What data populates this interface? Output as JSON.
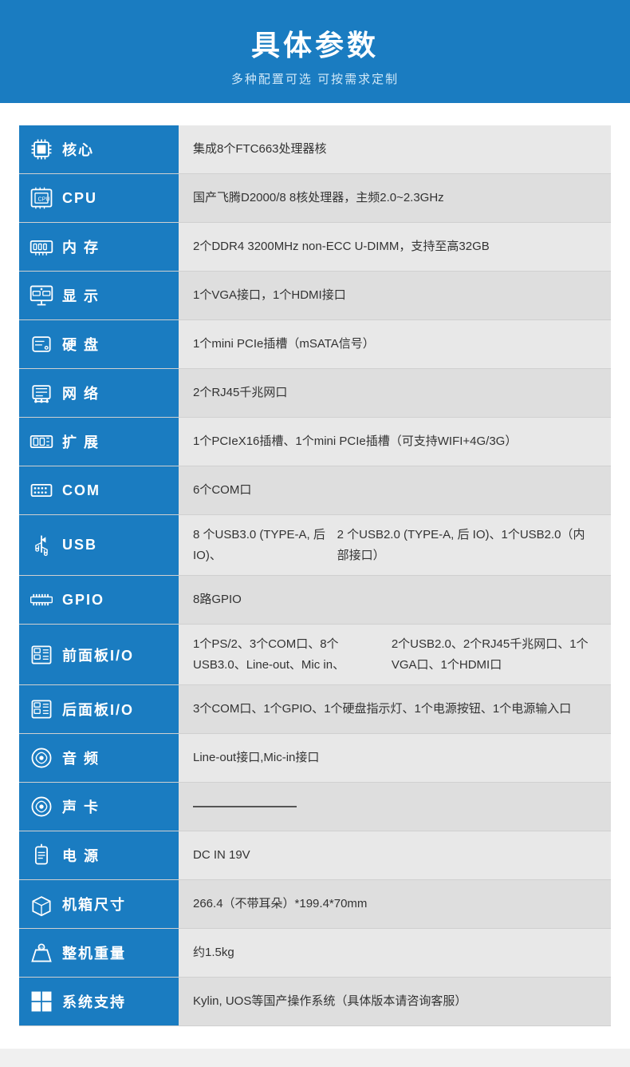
{
  "header": {
    "title": "具体参数",
    "subtitle": "多种配置可选 可按需求定制"
  },
  "rows": [
    {
      "id": "core",
      "label": "核心",
      "value": "集成8个FTC663处理器核",
      "icon": "chip"
    },
    {
      "id": "cpu",
      "label": "CPU",
      "value": "国产飞腾D2000/8  8核处理器，主频2.0~2.3GHz",
      "icon": "cpu"
    },
    {
      "id": "ram",
      "label": "内  存",
      "value": "2个DDR4 3200MHz non-ECC U-DIMM，\n支持至高32GB",
      "icon": "ram"
    },
    {
      "id": "display",
      "label": "显  示",
      "value": "1个VGA接口，1个HDMI接口",
      "icon": "display"
    },
    {
      "id": "hdd",
      "label": "硬  盘",
      "value": "1个mini PCIe插槽（mSATA信号）",
      "icon": "hdd"
    },
    {
      "id": "network",
      "label": "网  络",
      "value": "2个RJ45千兆网口",
      "icon": "network"
    },
    {
      "id": "expand",
      "label": "扩  展",
      "value": "1个PCIeX16插槽、1个mini PCIe插槽（可支持WIFI+4G/3G）",
      "icon": "expand"
    },
    {
      "id": "com",
      "label": "COM",
      "value": "6个COM口",
      "icon": "com"
    },
    {
      "id": "usb",
      "label": "USB",
      "value": "8 个USB3.0 (TYPE-A, 后 IO)、\n2 个USB2.0 (TYPE-A, 后 IO)、1个USB2.0（内部接口）",
      "icon": "usb"
    },
    {
      "id": "gpio",
      "label": "GPIO",
      "value": "8路GPIO",
      "icon": "gpio"
    },
    {
      "id": "front-panel",
      "label": "前面板I/O",
      "value": "1个PS/2、3个COM口、8个USB3.0、Line-out、Mic in、\n2个USB2.0、2个RJ45千兆网口、1个VGA口、1个HDMI口",
      "icon": "panel"
    },
    {
      "id": "rear-panel",
      "label": "后面板I/O",
      "value": "3个COM口、1个GPIO、1个硬盘指示灯、1个电源按钮、\n1个电源输入口",
      "icon": "panel"
    },
    {
      "id": "audio",
      "label": "音  频",
      "value": "Line-out接口,Mic-in接口",
      "icon": "audio"
    },
    {
      "id": "soundcard",
      "label": "声  卡",
      "value": "——————————",
      "icon": "audio"
    },
    {
      "id": "power",
      "label": "电  源",
      "value": "DC IN 19V",
      "icon": "power"
    },
    {
      "id": "dimension",
      "label": "机箱尺寸",
      "value": "266.4（不带耳朵）*199.4*70mm",
      "icon": "box"
    },
    {
      "id": "weight",
      "label": "整机重量",
      "value": "约1.5kg",
      "icon": "weight"
    },
    {
      "id": "os",
      "label": "系统支持",
      "value": "Kylin, UOS等国产操作系统（具体版本请咨询客服）",
      "icon": "windows"
    }
  ]
}
